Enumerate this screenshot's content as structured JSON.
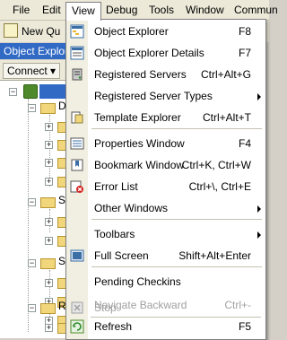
{
  "menubar": {
    "items": [
      {
        "label": "File"
      },
      {
        "label": "Edit"
      },
      {
        "label": "View"
      },
      {
        "label": "Debug"
      },
      {
        "label": "Tools"
      },
      {
        "label": "Window"
      },
      {
        "label": "Commun"
      }
    ]
  },
  "toolbar": {
    "new_query_label": "New Qu"
  },
  "object_explorer": {
    "title": "Object Explore",
    "connect_label": "Connect ▾",
    "tree_letters": [
      "D",
      "S",
      "S",
      "R"
    ]
  },
  "view_menu": {
    "items": [
      {
        "label": "Object Explorer",
        "shortcut": "F8",
        "icon": "object-explorer-icon"
      },
      {
        "label": "Object Explorer Details",
        "shortcut": "F7",
        "icon": "object-explorer-details-icon"
      },
      {
        "label": "Registered Servers",
        "shortcut": "Ctrl+Alt+G",
        "icon": "registered-servers-icon"
      },
      {
        "label": "Registered Server Types",
        "shortcut": "",
        "icon": "",
        "submenu": true
      },
      {
        "label": "Template Explorer",
        "shortcut": "Ctrl+Alt+T",
        "icon": "template-explorer-icon"
      },
      {
        "label": "Properties Window",
        "shortcut": "F4",
        "icon": "properties-window-icon"
      },
      {
        "label": "Bookmark Window",
        "shortcut": "Ctrl+K, Ctrl+W",
        "icon": "bookmark-window-icon"
      },
      {
        "label": "Error List",
        "shortcut": "Ctrl+\\, Ctrl+E",
        "icon": "error-list-icon"
      },
      {
        "label": "Other Windows",
        "shortcut": "",
        "icon": "",
        "submenu": true
      },
      {
        "label": "Toolbars",
        "shortcut": "",
        "icon": "",
        "submenu": true
      },
      {
        "label": "Full Screen",
        "shortcut": "Shift+Alt+Enter",
        "icon": "full-screen-icon"
      },
      {
        "label": "Pending Checkins",
        "shortcut": "",
        "icon": ""
      },
      {
        "label": "Navigate Backward",
        "shortcut": "Ctrl+-",
        "icon": "",
        "disabled": true
      },
      {
        "label": "Stop",
        "shortcut": "",
        "icon": "stop-icon",
        "disabled": true
      },
      {
        "label": "Refresh",
        "shortcut": "F5",
        "icon": "refresh-icon"
      }
    ]
  }
}
